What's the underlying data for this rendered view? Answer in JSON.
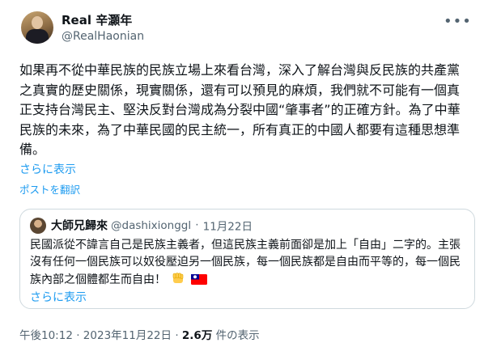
{
  "author": {
    "display_name": "Real 辛灝年",
    "handle": "@RealHaonian"
  },
  "more_menu_icon": "more-horizontal-icon",
  "tweet": {
    "text": "如果再不從中華民族的民族立場上來看台灣，深入了解台灣與反民族的共產黨之真實的歷史關係，現實關係，還有可以預見的麻煩，我們就不可能有一個真正支持台灣民主、堅決反對台灣成為分裂中國“肇事者”的正確方針。為了中華民族的未來，為了中華民國的民主統一，所有真正的中國人都要有這種思想準備。",
    "show_more": "さらに表示",
    "translate": "ポストを翻訳"
  },
  "quote": {
    "display_name": "大師兄歸來",
    "handle": "@dashixionggl",
    "separator": "·",
    "date": "11月22日",
    "text": "民國派從不諱言自己是民族主義者，但這民族主義前面卻是加上「自由」二字的。主張沒有任何一個民族可以奴役壓迫另一個民族，每一個民族都是自由而平等的，每一個民族內部之個體都生而自由！",
    "emojis": [
      "raised-fist",
      "taiwan-flag"
    ],
    "show_more": "さらに表示"
  },
  "meta": {
    "time": "午後10:12",
    "separator": "·",
    "date": "2023年11月22日",
    "views_count": "2.6万",
    "views_label": "件の表示"
  },
  "colors": {
    "link": "#1d9bf0",
    "secondary_text": "#536471",
    "border": "#cfd9de",
    "flag_red": "#fe0000",
    "flag_blue": "#000095"
  }
}
